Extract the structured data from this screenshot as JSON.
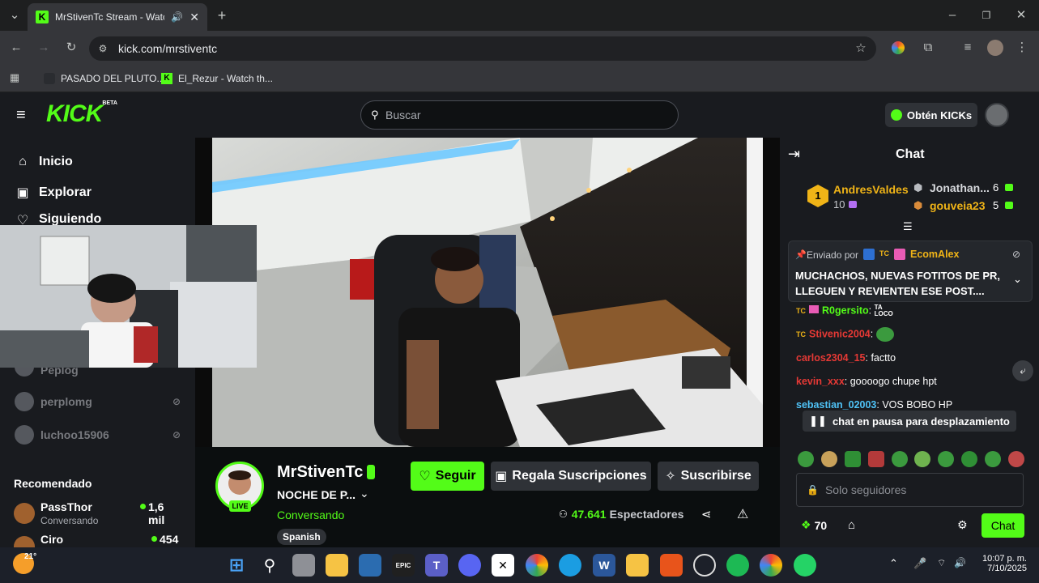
{
  "browser": {
    "tab_title": "MrStivenTc Stream - Watch",
    "new_tab_icon": "plus-icon",
    "url": "kick.com/mrstiventc",
    "bookmarks": [
      {
        "label": "PASADO DEL PLUTO..."
      },
      {
        "label": "El_Rezur - Watch th..."
      }
    ]
  },
  "kick": {
    "logo": "KICK",
    "logo_badge": "BETA",
    "search_placeholder": "Buscar",
    "get_kicks": "Obtén KICKs",
    "brand_color": "#53fc18"
  },
  "sidebar": {
    "nav": [
      {
        "label": "Inicio",
        "icon": "home-icon"
      },
      {
        "label": "Explorar",
        "icon": "compass-icon"
      },
      {
        "label": "Siguiendo",
        "icon": "heart-icon"
      }
    ],
    "followed": [
      {
        "name": "Peplog"
      },
      {
        "name": "perplomg"
      },
      {
        "name": "luchoo15906"
      }
    ],
    "recommended_title": "Recomendado",
    "recommended": [
      {
        "name": "PassThor",
        "sub": "Conversando",
        "viewers": "1,6 mil"
      },
      {
        "name": "Ciro",
        "sub": "",
        "viewers": "454"
      }
    ]
  },
  "channel": {
    "name": "MrStivenTc",
    "live_badge": "LIVE",
    "title": "NOCHE DE P...",
    "category": "Conversando",
    "tag": "Spanish",
    "follow": "Seguir",
    "gift": "Regala Suscripciones",
    "subscribe": "Suscribirse",
    "viewers_count": "47.641",
    "viewers_label": "Espectadores"
  },
  "chat": {
    "title": "Chat",
    "leaderboard": {
      "first": {
        "rank": "1",
        "name": "AndresValdes",
        "count": "10"
      },
      "second": {
        "name": "Jonathan...",
        "count": "6"
      },
      "third": {
        "name": "gouveia23",
        "count": "5"
      }
    },
    "pinned": {
      "label": "Enviado por",
      "author": "EcomAlex",
      "message": "MUCHACHOS, NUEVAS FOTITOS DE PR, LLEGUEN Y REVIENTEN ESE POST...."
    },
    "messages": [
      {
        "user": "R0gersito",
        "text": "",
        "color": "#53fc18"
      },
      {
        "user": "Stivenic2004",
        "text": "",
        "color": "#e53935"
      },
      {
        "user": "carlos2304_15",
        "text": "factto",
        "color": "#e53935"
      },
      {
        "user": "kevin_xxx",
        "text": "goooogo chupe hpt",
        "color": "#e53935"
      },
      {
        "user": "sebastian_02003",
        "text": "VOS BOBO HP",
        "color": "#4fc3f7"
      }
    ],
    "paused_notice": "chat en pausa para desplazamiento",
    "input_placeholder": "Solo seguidores",
    "points": "70",
    "send": "Chat"
  },
  "taskbar": {
    "weather": "21°",
    "time": "10:07 p. m.",
    "date": "7/10/2025"
  }
}
